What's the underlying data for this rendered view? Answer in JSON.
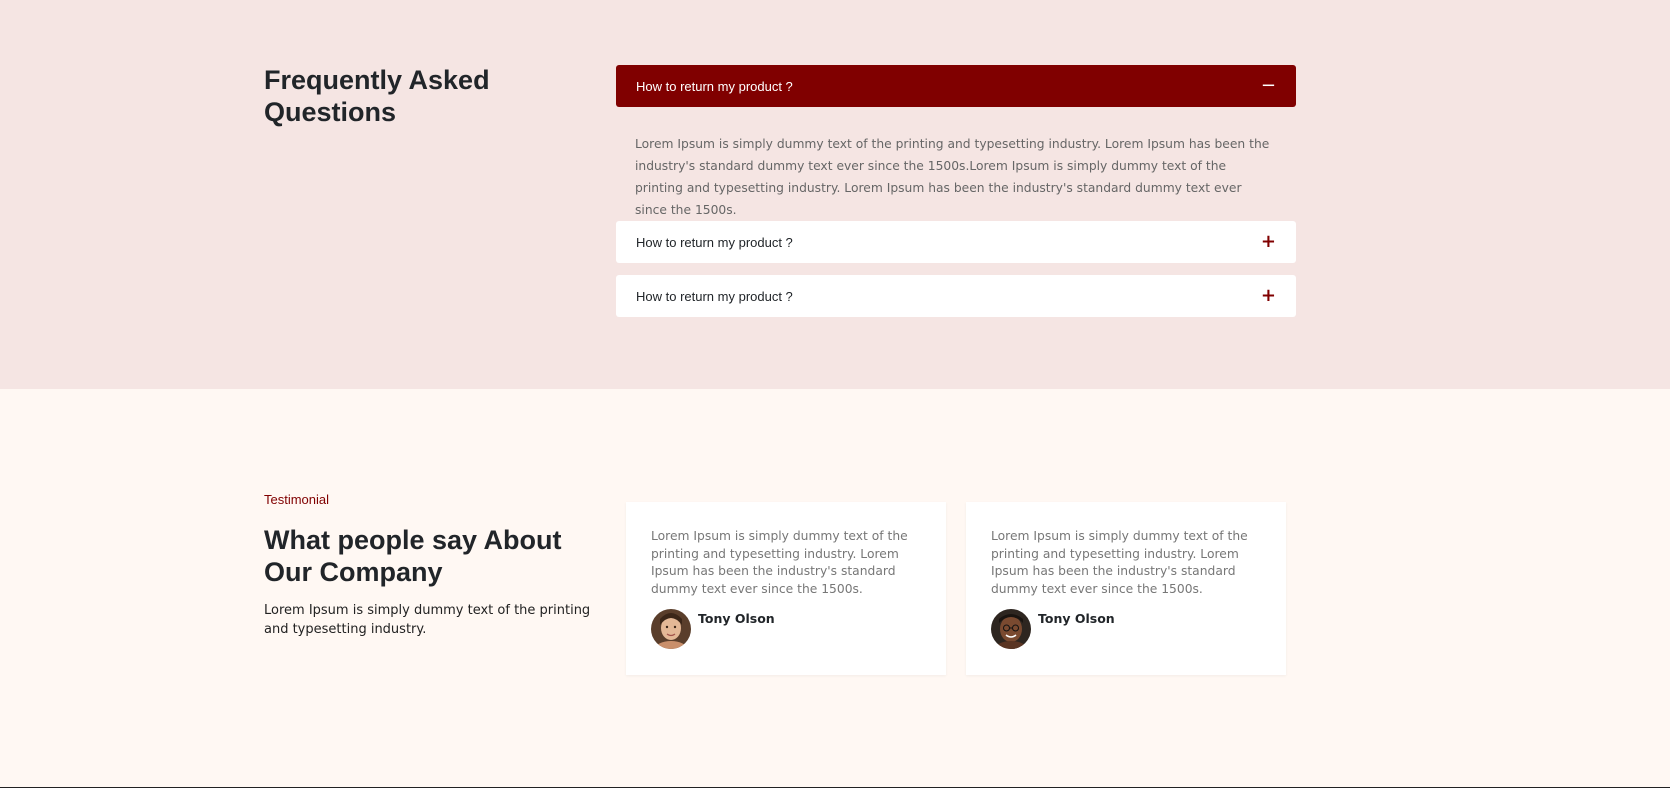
{
  "faq": {
    "title": "Frequently Asked Questions",
    "items": [
      {
        "question": "How to return my product ?",
        "expanded": true,
        "icon": "minus-icon",
        "answer": "Lorem Ipsum is simply dummy text of the printing and typesetting industry. Lorem Ipsum has been the industry's standard dummy text ever since the 1500s.Lorem Ipsum is simply dummy text of the printing and typesetting industry. Lorem Ipsum has been the industry's standard dummy text ever since the 1500s."
      },
      {
        "question": "How to return my product ?",
        "expanded": false,
        "icon": "plus-icon"
      },
      {
        "question": "How to return my product ?",
        "expanded": false,
        "icon": "plus-icon"
      }
    ],
    "icons": {
      "minus": "−",
      "plus": "+"
    }
  },
  "testimonial": {
    "tag": "Testimonial",
    "title": "What people say About Our Company",
    "description": "Lorem Ipsum is simply dummy text of the printing and typesetting industry.",
    "cards": [
      {
        "text": "Lorem Ipsum is simply dummy text of the printing and typesetting industry. Lorem Ipsum has been the industry's standard dummy text ever since the 1500s.",
        "name": "Tony Olson"
      },
      {
        "text": "Lorem Ipsum is simply dummy text of the printing and typesetting industry. Lorem Ipsum has been the industry's standard dummy text ever since the 1500s.",
        "name": "Tony Olson"
      }
    ]
  },
  "colors": {
    "accent": "#800000",
    "faq_bg": "#f5e5e3",
    "testimonial_bg": "#fff8f3"
  }
}
